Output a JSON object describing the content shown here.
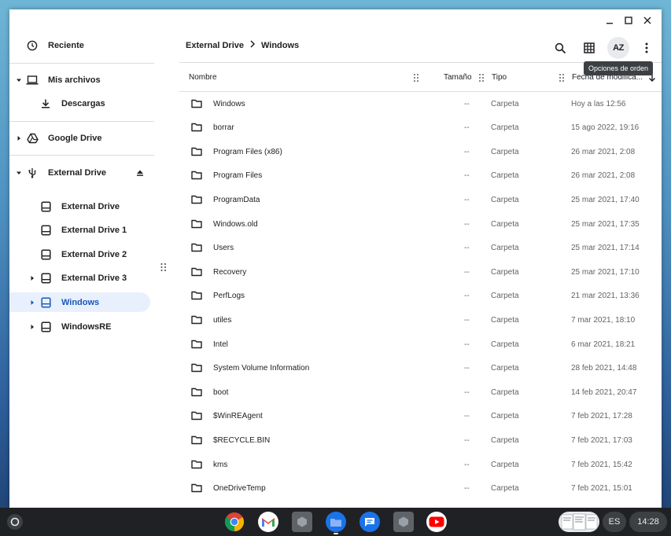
{
  "window": {
    "controls": [
      "minimize",
      "maximize",
      "close"
    ]
  },
  "sidebar": {
    "recent": {
      "label": "Reciente",
      "icon": "clock-icon"
    },
    "my_files": {
      "label": "Mis archivos",
      "icon": "laptop-icon"
    },
    "downloads": {
      "label": "Descargas",
      "icon": "download-icon"
    },
    "google_drive": {
      "label": "Google Drive",
      "icon": "drive-icon"
    },
    "external_drive": {
      "label": "External Drive",
      "icon": "usb-icon"
    },
    "drives": [
      {
        "label": "External Drive",
        "expandable": false
      },
      {
        "label": "External Drive 1",
        "expandable": false
      },
      {
        "label": "External Drive 2",
        "expandable": false
      },
      {
        "label": "External Drive 3",
        "expandable": true
      },
      {
        "label": "Windows",
        "expandable": true,
        "selected": true
      },
      {
        "label": "WindowsRE",
        "expandable": true
      }
    ]
  },
  "header": {
    "breadcrumb": [
      "External Drive",
      "Windows"
    ],
    "tools": [
      "search-icon",
      "grid-view-icon",
      "sort-icon",
      "more-vert-icon"
    ],
    "sort_label": "AZ",
    "tooltip": "Opciones de orden"
  },
  "table": {
    "columns": {
      "name": "Nombre",
      "size": "Tamaño",
      "type": "Tipo",
      "date": "Fecha de modifica..."
    },
    "rows": [
      {
        "name": "Windows",
        "size": "--",
        "type": "Carpeta",
        "date": "Hoy a las 12:56"
      },
      {
        "name": "borrar",
        "size": "--",
        "type": "Carpeta",
        "date": "15 ago 2022, 19:16"
      },
      {
        "name": "Program Files (x86)",
        "size": "--",
        "type": "Carpeta",
        "date": "26 mar 2021, 2:08"
      },
      {
        "name": "Program Files",
        "size": "--",
        "type": "Carpeta",
        "date": "26 mar 2021, 2:08"
      },
      {
        "name": "ProgramData",
        "size": "--",
        "type": "Carpeta",
        "date": "25 mar 2021, 17:40"
      },
      {
        "name": "Windows.old",
        "size": "--",
        "type": "Carpeta",
        "date": "25 mar 2021, 17:35"
      },
      {
        "name": "Users",
        "size": "--",
        "type": "Carpeta",
        "date": "25 mar 2021, 17:14"
      },
      {
        "name": "Recovery",
        "size": "--",
        "type": "Carpeta",
        "date": "25 mar 2021, 17:10"
      },
      {
        "name": "PerfLogs",
        "size": "--",
        "type": "Carpeta",
        "date": "21 mar 2021, 13:36"
      },
      {
        "name": "utiles",
        "size": "--",
        "type": "Carpeta",
        "date": "7 mar 2021, 18:10"
      },
      {
        "name": "Intel",
        "size": "--",
        "type": "Carpeta",
        "date": "6 mar 2021, 18:21"
      },
      {
        "name": "System Volume Information",
        "size": "--",
        "type": "Carpeta",
        "date": "28 feb 2021, 14:48"
      },
      {
        "name": "boot",
        "size": "--",
        "type": "Carpeta",
        "date": "14 feb 2021, 20:47"
      },
      {
        "name": "$WinREAgent",
        "size": "--",
        "type": "Carpeta",
        "date": "7 feb 2021, 17:28"
      },
      {
        "name": "$RECYCLE.BIN",
        "size": "--",
        "type": "Carpeta",
        "date": "7 feb 2021, 17:03"
      },
      {
        "name": "kms",
        "size": "--",
        "type": "Carpeta",
        "date": "7 feb 2021, 15:42"
      },
      {
        "name": "OneDriveTemp",
        "size": "--",
        "type": "Carpeta",
        "date": "7 feb 2021, 15:01"
      }
    ]
  },
  "shelf": {
    "apps": [
      "chrome-icon",
      "gmail-icon",
      "app-icon",
      "files-icon",
      "messages-icon",
      "app-icon",
      "youtube-icon"
    ],
    "language": "ES",
    "time": "14:28"
  },
  "colors": {
    "accent": "#1a73e8",
    "selected_bg": "#e8f0fe",
    "selected_text": "#1a57b6",
    "shelf": "#202124"
  }
}
